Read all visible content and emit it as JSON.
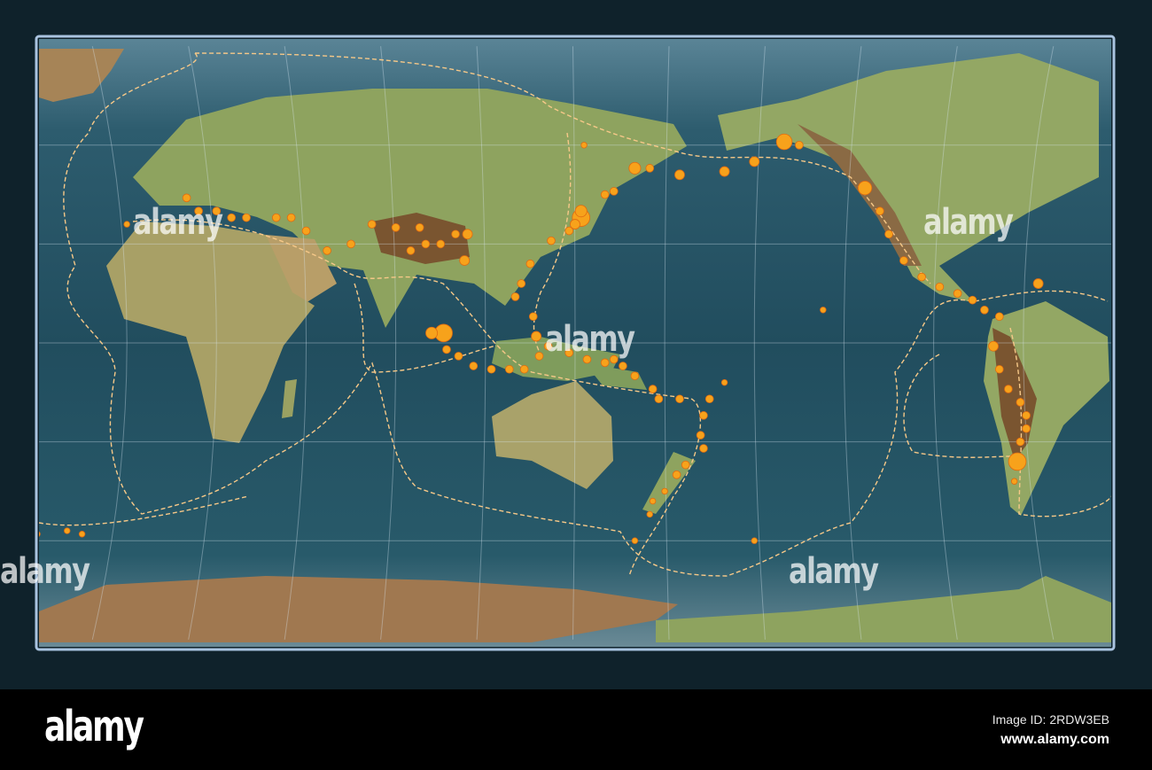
{
  "footer": {
    "brand": "alamy",
    "image_id": "Image ID: 2RDW3EB",
    "url": "www.alamy.com"
  },
  "watermark": "alamy",
  "map": {
    "title": "Tectonic plates and earthquakes on elevation map, Pacific-centered",
    "colors": {
      "ocean": "#2c5868",
      "land": "#8fa860",
      "desert": "#b49a64",
      "ice": "#b08c5c",
      "quake": "#f7a21b",
      "boundary": "#f4c27a"
    },
    "quakes": [
      [
        143,
        60,
        3
      ],
      [
        -150,
        61,
        8
      ],
      [
        -145,
        60,
        4
      ],
      [
        -160,
        55,
        5
      ],
      [
        -170,
        52,
        5
      ],
      [
        175,
        51,
        5
      ],
      [
        165,
        53,
        4
      ],
      [
        160,
        53,
        6
      ],
      [
        153,
        46,
        4
      ],
      [
        150,
        45,
        4
      ],
      [
        142,
        38,
        9
      ],
      [
        140,
        36,
        5
      ],
      [
        142,
        40,
        6
      ],
      [
        138,
        34,
        4
      ],
      [
        132,
        31,
        4
      ],
      [
        125,
        24,
        4
      ],
      [
        122,
        18,
        4
      ],
      [
        120,
        14,
        4
      ],
      [
        126,
        8,
        4
      ],
      [
        127,
        2,
        5
      ],
      [
        96,
        3,
        9
      ],
      [
        92,
        3,
        6
      ],
      [
        97,
        -2,
        4
      ],
      [
        101,
        -4,
        4
      ],
      [
        106,
        -7,
        4
      ],
      [
        112,
        -8,
        4
      ],
      [
        118,
        -8,
        4
      ],
      [
        123,
        -8,
        4
      ],
      [
        128,
        -4,
        4
      ],
      [
        131,
        -1,
        4
      ],
      [
        138,
        -3,
        4
      ],
      [
        144,
        -5,
        4
      ],
      [
        150,
        -6,
        4
      ],
      [
        153,
        -5,
        4
      ],
      [
        156,
        -7,
        4
      ],
      [
        160,
        -10,
        4
      ],
      [
        166,
        -14,
        4
      ],
      [
        168,
        -17,
        4
      ],
      [
        175,
        -17,
        4
      ],
      [
        -175,
        -17,
        4
      ],
      [
        -177,
        -22,
        4
      ],
      [
        -178,
        -28,
        4
      ],
      [
        -177,
        -32,
        4
      ],
      [
        177,
        -37,
        4
      ],
      [
        174,
        -40,
        4
      ],
      [
        170,
        -45,
        3
      ],
      [
        166,
        -48,
        3
      ],
      [
        165,
        -52,
        3
      ],
      [
        160,
        -60,
        3
      ],
      [
        -123,
        47,
        7
      ],
      [
        -118,
        40,
        4
      ],
      [
        -115,
        33,
        4
      ],
      [
        -110,
        25,
        4
      ],
      [
        -104,
        20,
        4
      ],
      [
        -98,
        17,
        4
      ],
      [
        -92,
        15,
        4
      ],
      [
        -87,
        13,
        4
      ],
      [
        -83,
        10,
        4
      ],
      [
        -78,
        8,
        4
      ],
      [
        -80,
        -1,
        5
      ],
      [
        -78,
        -8,
        4
      ],
      [
        -75,
        -14,
        4
      ],
      [
        -71,
        -18,
        4
      ],
      [
        -69,
        -22,
        4
      ],
      [
        -69,
        -26,
        4
      ],
      [
        -71,
        -30,
        4
      ],
      [
        -72,
        -36,
        9
      ],
      [
        -73,
        -42,
        3
      ],
      [
        -65,
        18,
        5
      ],
      [
        85,
        28,
        4
      ],
      [
        90,
        30,
        4
      ],
      [
        95,
        30,
        4
      ],
      [
        100,
        33,
        4
      ],
      [
        88,
        35,
        4
      ],
      [
        80,
        35,
        4
      ],
      [
        72,
        36,
        4
      ],
      [
        65,
        30,
        4
      ],
      [
        57,
        28,
        4
      ],
      [
        50,
        34,
        4
      ],
      [
        45,
        38,
        4
      ],
      [
        40,
        38,
        4
      ],
      [
        30,
        38,
        4
      ],
      [
        25,
        38,
        4
      ],
      [
        20,
        40,
        4
      ],
      [
        14,
        40,
        4
      ],
      [
        10,
        44,
        4
      ],
      [
        -10,
        36,
        3
      ],
      [
        103,
        25,
        5
      ],
      [
        104,
        33,
        5
      ],
      [
        -40,
        -58,
        3
      ],
      [
        -30,
        -57,
        3
      ],
      [
        -25,
        -58,
        3
      ],
      [
        -170,
        -12,
        3
      ],
      [
        -137,
        10,
        3
      ],
      [
        -160,
        -60,
        3
      ]
    ]
  }
}
